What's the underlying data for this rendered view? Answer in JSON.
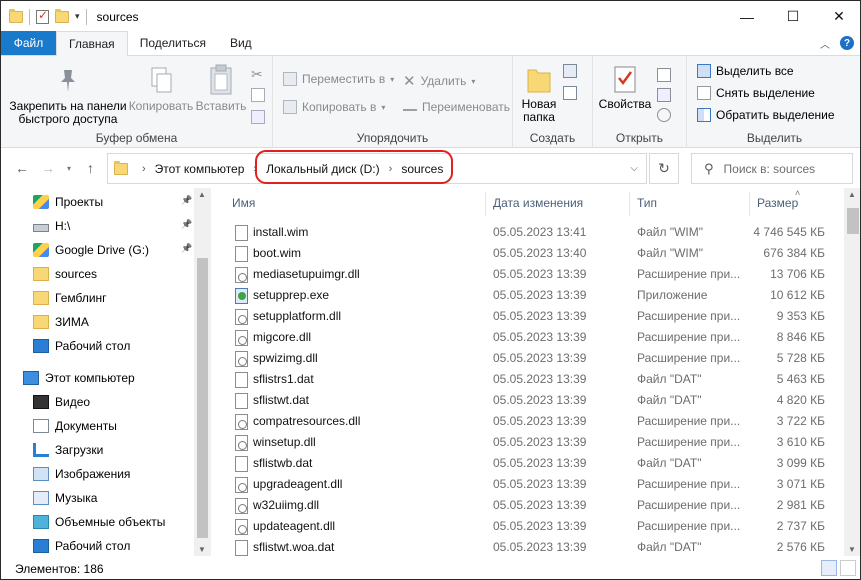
{
  "window": {
    "title": "sources"
  },
  "ribbon_tabs": {
    "file": "Файл",
    "home": "Главная",
    "share": "Поделиться",
    "view": "Вид"
  },
  "ribbon": {
    "clipboard": {
      "label": "Буфер обмена",
      "pin": [
        "Закрепить на панели",
        "быстрого доступа"
      ],
      "copy": "Копировать",
      "paste": "Вставить"
    },
    "organize": {
      "label": "Упорядочить",
      "move_to": "Переместить в",
      "copy_to": "Копировать в",
      "delete": "Удалить",
      "rename": "Переименовать"
    },
    "create": {
      "label": "Создать",
      "new_folder": [
        "Новая",
        "папка"
      ]
    },
    "open": {
      "label": "Открыть",
      "properties": "Свойства"
    },
    "select": {
      "label": "Выделить",
      "select_all": "Выделить все",
      "select_none": "Снять выделение",
      "invert": "Обратить выделение"
    }
  },
  "address": {
    "segments": [
      "Этот компьютер",
      "Локальный диск (D:)",
      "sources"
    ]
  },
  "search": {
    "placeholder": "Поиск в: sources"
  },
  "nav": {
    "items": [
      {
        "label": "Проекты",
        "icon": "google-drive-icon",
        "pinned": true
      },
      {
        "label": "H:\\",
        "icon": "drive-icon",
        "pinned": true
      },
      {
        "label": "Google Drive (G:)",
        "icon": "google-drive-icon",
        "pinned": true
      },
      {
        "label": "sources",
        "icon": "folder-icon",
        "pinned": false
      },
      {
        "label": "Гемблинг",
        "icon": "folder-icon",
        "pinned": false
      },
      {
        "label": "ЗИМА",
        "icon": "folder-icon",
        "pinned": false
      },
      {
        "label": "Рабочий стол",
        "icon": "desktop-icon",
        "pinned": false
      },
      {
        "label": "Этот компьютер",
        "icon": "computer-icon",
        "pinned": false
      },
      {
        "label": "Видео",
        "icon": "video-icon",
        "pinned": false
      },
      {
        "label": "Документы",
        "icon": "documents-icon",
        "pinned": false
      },
      {
        "label": "Загрузки",
        "icon": "downloads-icon",
        "pinned": false
      },
      {
        "label": "Изображения",
        "icon": "pictures-icon",
        "pinned": false
      },
      {
        "label": "Музыка",
        "icon": "music-icon",
        "pinned": false
      },
      {
        "label": "Объемные объекты",
        "icon": "3d-objects-icon",
        "pinned": false
      },
      {
        "label": "Рабочий стол",
        "icon": "desktop-icon",
        "pinned": false
      }
    ]
  },
  "columns": {
    "name": "Имя",
    "date": "Дата изменения",
    "type": "Тип",
    "size": "Размер"
  },
  "files": [
    {
      "name": "install.wim",
      "date": "05.05.2023 13:41",
      "type": "Файл \"WIM\"",
      "size": "4 746 545 КБ",
      "kind": "file"
    },
    {
      "name": "boot.wim",
      "date": "05.05.2023 13:40",
      "type": "Файл \"WIM\"",
      "size": "676 384 КБ",
      "kind": "file"
    },
    {
      "name": "mediasetupuimgr.dll",
      "date": "05.05.2023 13:39",
      "type": "Расширение при...",
      "size": "13 706 КБ",
      "kind": "dll"
    },
    {
      "name": "setupprep.exe",
      "date": "05.05.2023 13:39",
      "type": "Приложение",
      "size": "10 612 КБ",
      "kind": "exe"
    },
    {
      "name": "setupplatform.dll",
      "date": "05.05.2023 13:39",
      "type": "Расширение при...",
      "size": "9 353 КБ",
      "kind": "dll"
    },
    {
      "name": "migcore.dll",
      "date": "05.05.2023 13:39",
      "type": "Расширение при...",
      "size": "8 846 КБ",
      "kind": "dll"
    },
    {
      "name": "spwizimg.dll",
      "date": "05.05.2023 13:39",
      "type": "Расширение при...",
      "size": "5 728 КБ",
      "kind": "dll"
    },
    {
      "name": "sflistrs1.dat",
      "date": "05.05.2023 13:39",
      "type": "Файл \"DAT\"",
      "size": "5 463 КБ",
      "kind": "file"
    },
    {
      "name": "sflistwt.dat",
      "date": "05.05.2023 13:39",
      "type": "Файл \"DAT\"",
      "size": "4 820 КБ",
      "kind": "file"
    },
    {
      "name": "compatresources.dll",
      "date": "05.05.2023 13:39",
      "type": "Расширение при...",
      "size": "3 722 КБ",
      "kind": "dll"
    },
    {
      "name": "winsetup.dll",
      "date": "05.05.2023 13:39",
      "type": "Расширение при...",
      "size": "3 610 КБ",
      "kind": "dll"
    },
    {
      "name": "sflistwb.dat",
      "date": "05.05.2023 13:39",
      "type": "Файл \"DAT\"",
      "size": "3 099 КБ",
      "kind": "file"
    },
    {
      "name": "upgradeagent.dll",
      "date": "05.05.2023 13:39",
      "type": "Расширение при...",
      "size": "3 071 КБ",
      "kind": "dll"
    },
    {
      "name": "w32uiimg.dll",
      "date": "05.05.2023 13:39",
      "type": "Расширение при...",
      "size": "2 981 КБ",
      "kind": "dll"
    },
    {
      "name": "updateagent.dll",
      "date": "05.05.2023 13:39",
      "type": "Расширение при...",
      "size": "2 737 КБ",
      "kind": "dll"
    },
    {
      "name": "sflistwt.woa.dat",
      "date": "05.05.2023 13:39",
      "type": "Файл \"DAT\"",
      "size": "2 576 КБ",
      "kind": "file"
    }
  ],
  "status": {
    "items_count": "Элементов: 186"
  }
}
